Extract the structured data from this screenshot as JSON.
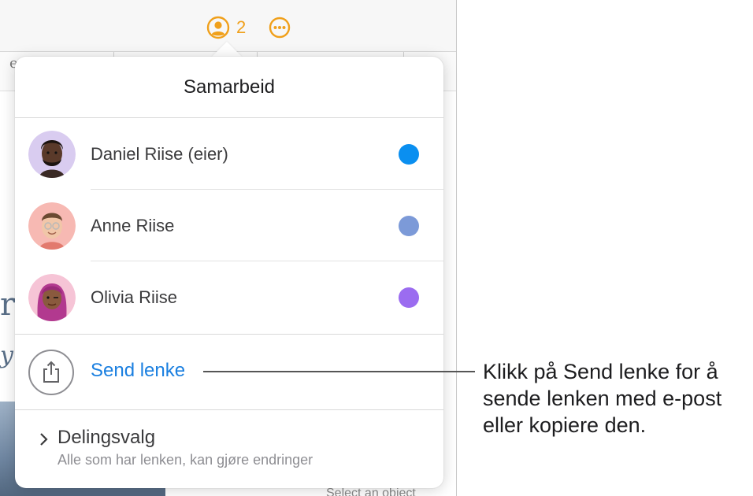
{
  "toolbar": {
    "collaborator_count": "2"
  },
  "popover": {
    "title": "Samarbeid",
    "participants": [
      {
        "name": "Daniel Riise (eier)",
        "color": "#0a8ff0"
      },
      {
        "name": "Anne Riise",
        "color": "#7c9ad8"
      },
      {
        "name": "Olivia Riise",
        "color": "#9b6cf0"
      }
    ],
    "send_link": "Send lenke",
    "sharing_options": {
      "title": "Delingsvalg",
      "subtitle": "Alle som har lenken, kan gjøre endringer"
    }
  },
  "callout": {
    "text": "Klikk på Send lenke for å sende lenken med e-post eller kopiere den."
  },
  "background": {
    "footer_text": "Select an object"
  },
  "colors": {
    "accent_orange": "#f0a01b",
    "link_blue": "#1a7fe0"
  }
}
